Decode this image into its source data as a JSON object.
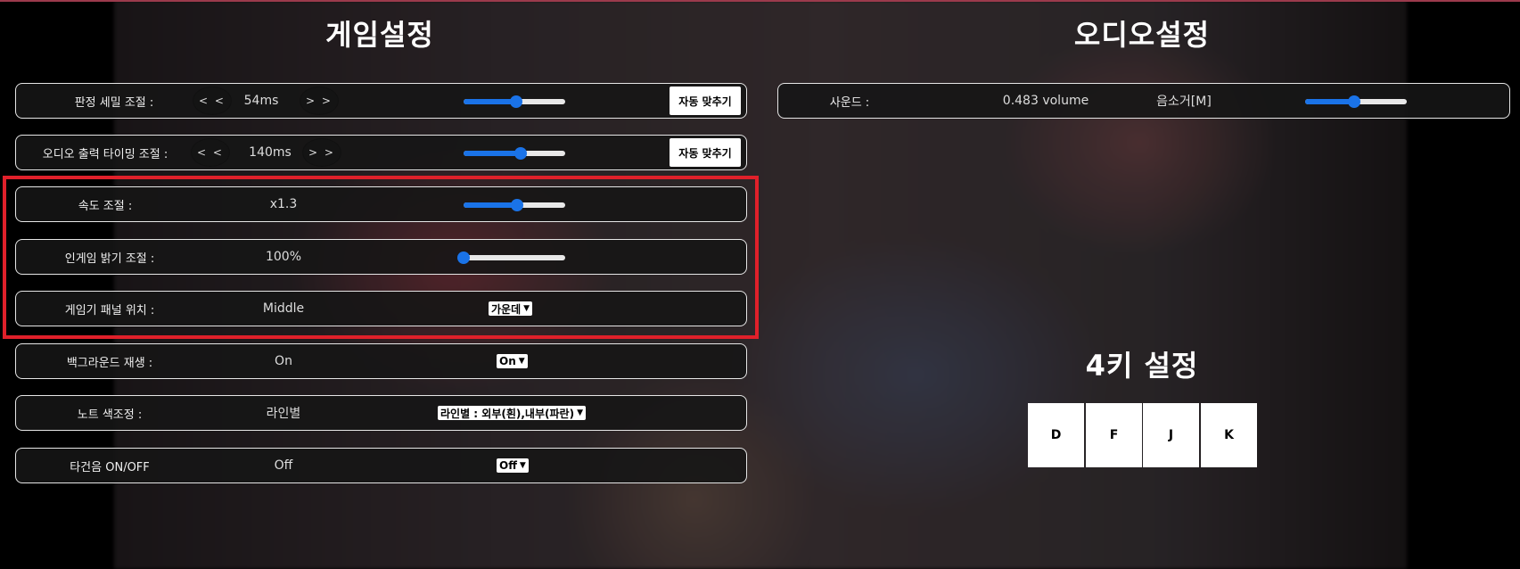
{
  "game_settings": {
    "title": "게임설정",
    "judge_detail": {
      "label": "판정 세밀 조절 :",
      "dec": "< <",
      "value": "54ms",
      "inc": "> >",
      "slider": 0.52,
      "auto": "자동 맞추기"
    },
    "audio_timing": {
      "label": "오디오 출력 타이밍 조절 :",
      "dec": "< <",
      "value": "140ms",
      "inc": "> >",
      "slider": 0.56,
      "auto": "자동 맞추기"
    },
    "speed": {
      "label": "속도 조절 :",
      "value": "x1.3",
      "slider": 0.53
    },
    "brightness": {
      "label": "인게임 밝기 조절 :",
      "value": "100%",
      "slider": 0.0
    },
    "gauge_panel": {
      "label": "게임기 패널 위치 :",
      "value": "Middle",
      "selected": "가운데"
    },
    "background_play": {
      "label": "백그라운드 재생 :",
      "value": "On",
      "selected": "On"
    },
    "note_color": {
      "label": "노트 색조정 :",
      "value": "라인별",
      "selected": "라인별 : 외부(흰),내부(파란)"
    },
    "hit_sound": {
      "label": "타건음 ON/OFF",
      "value": "Off",
      "selected": "Off"
    }
  },
  "audio_settings": {
    "title": "오디오설정",
    "sound": {
      "label": "사운드 :",
      "value": "0.483 volume",
      "mute": "음소거[M]",
      "slider": 0.48
    }
  },
  "key_settings": {
    "title": "4키 설정",
    "keys": [
      "D",
      "F",
      "J",
      "K"
    ]
  },
  "colors": {
    "accent": "#1a73e8",
    "highlight": "#e0202a",
    "panel_border": "#e6e6e6"
  }
}
